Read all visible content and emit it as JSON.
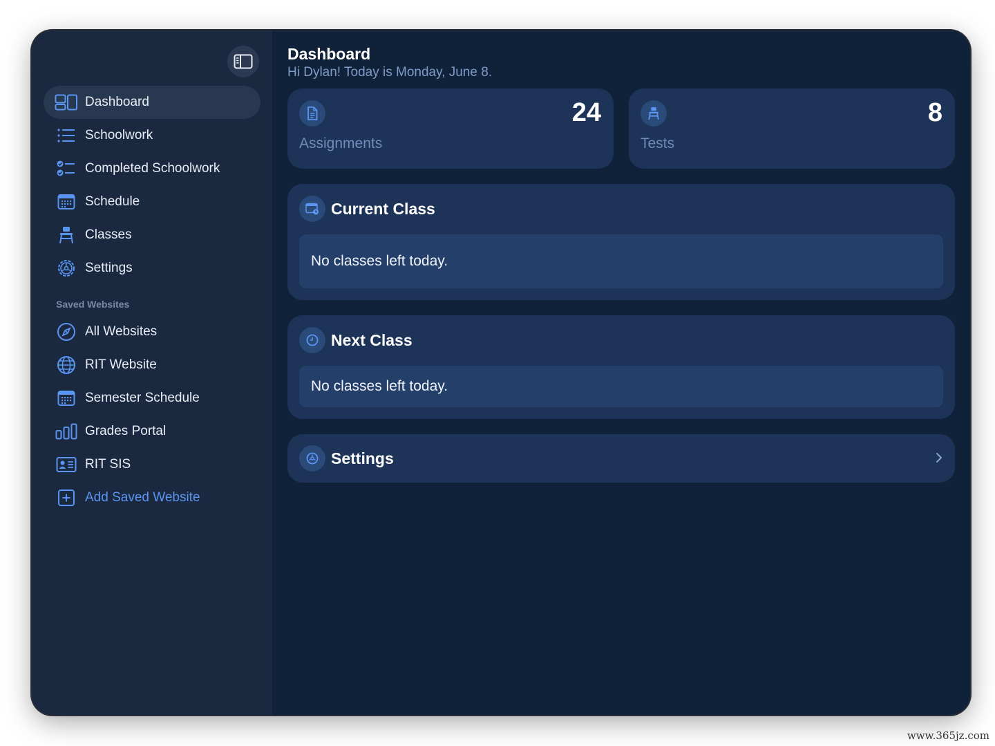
{
  "sidebar": {
    "items": [
      {
        "label": "Dashboard",
        "icon": "dashboard-icon"
      },
      {
        "label": "Schoolwork",
        "icon": "list-icon"
      },
      {
        "label": "Completed Schoolwork",
        "icon": "checklist-icon"
      },
      {
        "label": "Schedule",
        "icon": "calendar-icon"
      },
      {
        "label": "Classes",
        "icon": "desk-icon"
      },
      {
        "label": "Settings",
        "icon": "gear-icon"
      }
    ],
    "section_label": "Saved Websites",
    "websites": [
      {
        "label": "All Websites",
        "icon": "compass-icon"
      },
      {
        "label": "RIT Website",
        "icon": "globe-icon"
      },
      {
        "label": "Semester Schedule",
        "icon": "calendar-icon"
      },
      {
        "label": "Grades Portal",
        "icon": "bar-chart-icon"
      },
      {
        "label": "RIT SIS",
        "icon": "id-card-icon"
      }
    ],
    "add_label": "Add Saved Website"
  },
  "header": {
    "title": "Dashboard",
    "subtitle": "Hi Dylan! Today is Monday, June 8."
  },
  "stats": {
    "assignments": {
      "value": "24",
      "label": "Assignments"
    },
    "tests": {
      "value": "8",
      "label": "Tests"
    }
  },
  "current_class": {
    "title": "Current Class",
    "message": "No classes left today."
  },
  "next_class": {
    "title": "Next Class",
    "message": "No classes left today."
  },
  "settings_panel": {
    "title": "Settings"
  },
  "watermark": "www.365jz.com",
  "colors": {
    "accent": "#5a95f0",
    "sidebar_bg": "#1a2840",
    "main_bg": "#10213a",
    "card_bg": "#1d3458"
  }
}
